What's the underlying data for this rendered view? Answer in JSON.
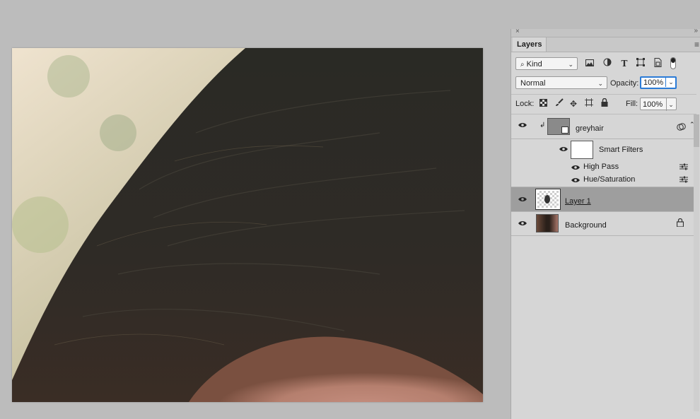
{
  "panel": {
    "tab_label": "Layers",
    "close_glyph": "×",
    "collapse_glyph": "»",
    "menu_glyph": "≡"
  },
  "filter": {
    "kind_label": "Kind",
    "kind_icon": "search-icon"
  },
  "blend": {
    "mode": "Normal",
    "opacity_label": "Opacity:",
    "opacity_value": "100%"
  },
  "lock": {
    "label": "Lock:",
    "fill_label": "Fill:",
    "fill_value": "100%"
  },
  "layers": [
    {
      "name": "greyhair",
      "type": "smart-object"
    },
    {
      "name": "Smart Filters",
      "type": "smart-filters"
    },
    {
      "name": "High Pass",
      "type": "filter"
    },
    {
      "name": "Hue/Saturation",
      "type": "filter"
    },
    {
      "name": "Layer 1",
      "type": "pixel",
      "selected": true
    },
    {
      "name": "Background",
      "type": "background",
      "locked": true
    }
  ],
  "colors": {
    "panel_bg": "#d6d6d6",
    "selected_row": "#9e9e9e",
    "workspace": "#bcbcbc",
    "accent": "#2b7bd6"
  }
}
